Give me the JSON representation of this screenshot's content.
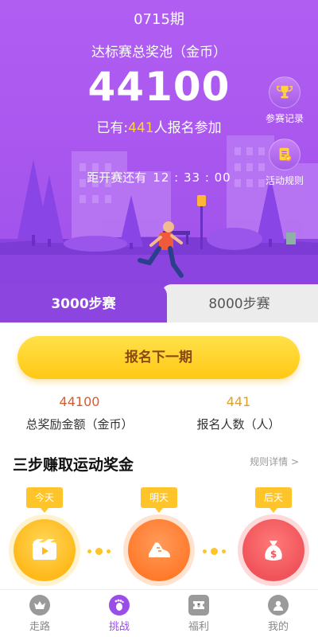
{
  "hero": {
    "period": "0715期",
    "pool_title": "达标赛总奖池（金币）",
    "pool_amount": "44100",
    "signed_prefix": "已有:",
    "signed_count": "441",
    "signed_suffix": "人报名参加",
    "countdown_label": "距开赛还有",
    "countdown_time": "12 : 33 : 00",
    "side_buttons": [
      {
        "label": "参赛记录",
        "icon": "trophy-icon"
      },
      {
        "label": "活动规则",
        "icon": "rules-document-icon"
      }
    ]
  },
  "tabs": {
    "active": "3000步赛",
    "inactive": "8000步赛"
  },
  "signup_button": "报名下一期",
  "stats": {
    "total_amount": "44100",
    "total_label": "总奖励金额（金币）",
    "people_count": "441",
    "people_label": "报名人数（人）"
  },
  "steps": {
    "title": "三步赚取运动奖金",
    "rules_link": "规则详情 >",
    "items": [
      {
        "tag": "今天",
        "icon": "video-play-icon"
      },
      {
        "tag": "明天",
        "icon": "running-shoe-icon"
      },
      {
        "tag": "后天",
        "icon": "money-bag-icon"
      }
    ]
  },
  "bottom_nav": [
    {
      "label": "走路",
      "icon": "crown-icon",
      "active": false
    },
    {
      "label": "挑战",
      "icon": "footprint-icon",
      "active": true
    },
    {
      "label": "福利",
      "icon": "ticket-icon",
      "active": false
    },
    {
      "label": "我的",
      "icon": "user-icon",
      "active": false
    }
  ],
  "colors": {
    "hero_purple": "#a957ee",
    "active_tab": "#8d45df",
    "button_yellow": "#ffc814",
    "highlight": "#ffd23c"
  }
}
